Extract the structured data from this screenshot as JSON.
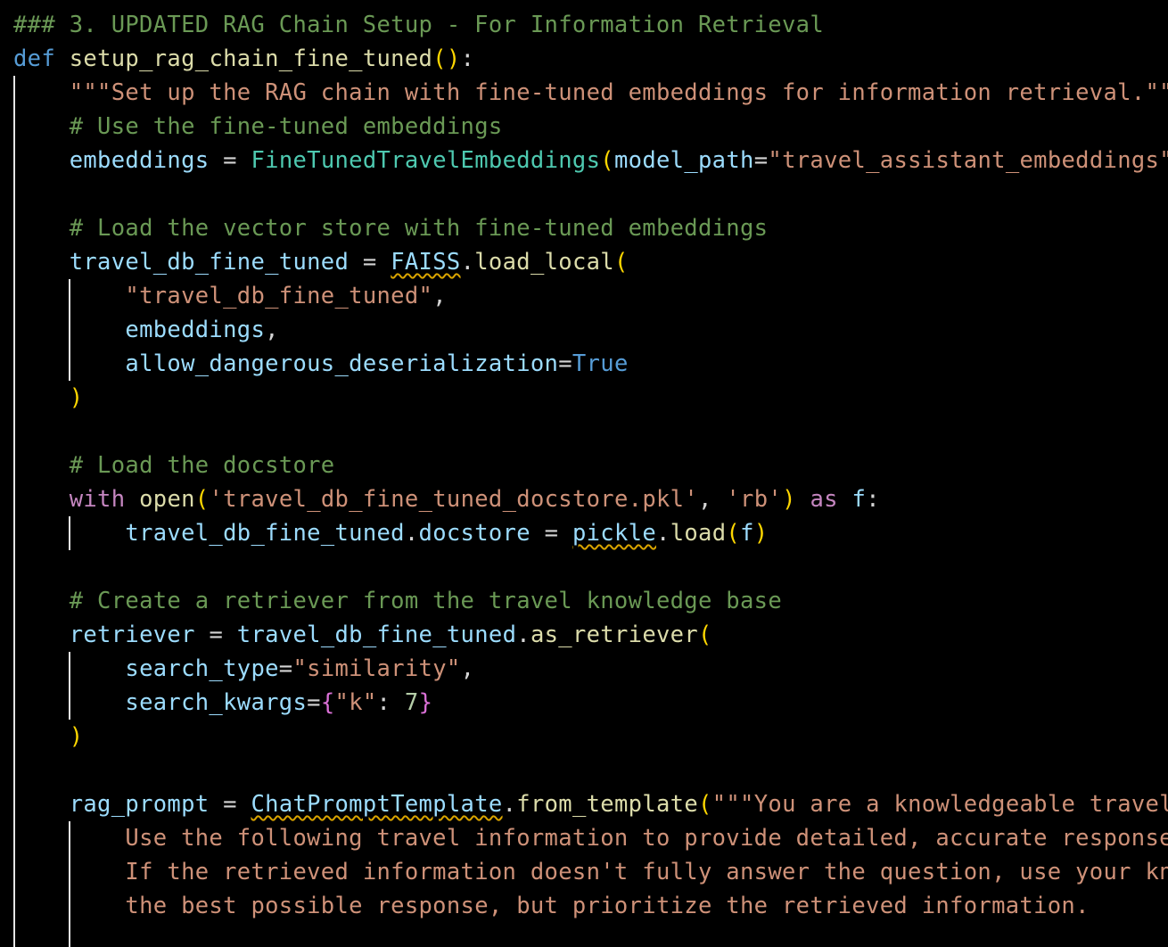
{
  "editor": {
    "language": "python",
    "theme_colors": {
      "background": "#000000",
      "comment": "#6a9955",
      "keyword": "#569cd6",
      "control": "#c586c0",
      "function": "#dcdcaa",
      "variable": "#9cdcfe",
      "class": "#4ec9b0",
      "string": "#ce9178",
      "number": "#b5cea8",
      "bracket_level_1": "#ffd700",
      "bracket_level_2": "#da70d6",
      "bracket_level_3": "#179fff",
      "warning_squiggle": "#d9a400",
      "indent_guide": "#e6e6e6"
    },
    "lines": [
      {
        "tokens": [
          {
            "t": "### 3. UPDATED RAG Chain Setup - For Information Retrieval",
            "c": "comment"
          }
        ]
      },
      {
        "tokens": [
          {
            "t": "def",
            "c": "keyword"
          },
          {
            "t": " ",
            "c": "op"
          },
          {
            "t": "setup_rag_chain_fine_tuned",
            "c": "func"
          },
          {
            "t": "()",
            "c": "bracket1"
          },
          {
            "t": ":",
            "c": "op"
          }
        ]
      },
      {
        "tokens": [
          {
            "t": "    ",
            "c": "op"
          },
          {
            "t": "\"\"\"Set up the RAG chain with fine-tuned embeddings for information retrieval.\"\"\"",
            "c": "string"
          }
        ]
      },
      {
        "tokens": [
          {
            "t": "    ",
            "c": "op"
          },
          {
            "t": "# Use the fine-tuned embeddings",
            "c": "comment"
          }
        ]
      },
      {
        "tokens": [
          {
            "t": "    ",
            "c": "op"
          },
          {
            "t": "embeddings",
            "c": "var"
          },
          {
            "t": " = ",
            "c": "op"
          },
          {
            "t": "FineTunedTravelEmbeddings",
            "c": "class"
          },
          {
            "t": "(",
            "c": "bracket1"
          },
          {
            "t": "model_path",
            "c": "var"
          },
          {
            "t": "=",
            "c": "op"
          },
          {
            "t": "\"travel_assistant_embeddings\"",
            "c": "string"
          },
          {
            "t": ")",
            "c": "bracket1"
          }
        ]
      },
      {
        "tokens": []
      },
      {
        "tokens": [
          {
            "t": "    ",
            "c": "op"
          },
          {
            "t": "# Load the vector store with fine-tuned embeddings",
            "c": "comment"
          }
        ]
      },
      {
        "tokens": [
          {
            "t": "    ",
            "c": "op"
          },
          {
            "t": "travel_db_fine_tuned",
            "c": "var"
          },
          {
            "t": " = ",
            "c": "op"
          },
          {
            "t": "FAISS",
            "c": "var",
            "warn": true
          },
          {
            "t": ".",
            "c": "op"
          },
          {
            "t": "load_local",
            "c": "func"
          },
          {
            "t": "(",
            "c": "bracket1"
          }
        ]
      },
      {
        "tokens": [
          {
            "t": "        ",
            "c": "op"
          },
          {
            "t": "\"travel_db_fine_tuned\"",
            "c": "string"
          },
          {
            "t": ",",
            "c": "op"
          }
        ]
      },
      {
        "tokens": [
          {
            "t": "        ",
            "c": "op"
          },
          {
            "t": "embeddings",
            "c": "var"
          },
          {
            "t": ",",
            "c": "op"
          }
        ]
      },
      {
        "tokens": [
          {
            "t": "        ",
            "c": "op"
          },
          {
            "t": "allow_dangerous_deserialization",
            "c": "var"
          },
          {
            "t": "=",
            "c": "op"
          },
          {
            "t": "True",
            "c": "keyword"
          }
        ]
      },
      {
        "tokens": [
          {
            "t": "    ",
            "c": "op"
          },
          {
            "t": ")",
            "c": "bracket1"
          }
        ]
      },
      {
        "tokens": []
      },
      {
        "tokens": [
          {
            "t": "    ",
            "c": "op"
          },
          {
            "t": "# Load the docstore",
            "c": "comment"
          }
        ]
      },
      {
        "tokens": [
          {
            "t": "    ",
            "c": "op"
          },
          {
            "t": "with",
            "c": "control"
          },
          {
            "t": " ",
            "c": "op"
          },
          {
            "t": "open",
            "c": "func"
          },
          {
            "t": "(",
            "c": "bracket1"
          },
          {
            "t": "'travel_db_fine_tuned_docstore.pkl'",
            "c": "string"
          },
          {
            "t": ", ",
            "c": "op"
          },
          {
            "t": "'rb'",
            "c": "string"
          },
          {
            "t": ")",
            "c": "bracket1"
          },
          {
            "t": " ",
            "c": "op"
          },
          {
            "t": "as",
            "c": "control"
          },
          {
            "t": " ",
            "c": "op"
          },
          {
            "t": "f",
            "c": "var"
          },
          {
            "t": ":",
            "c": "op"
          }
        ]
      },
      {
        "tokens": [
          {
            "t": "        ",
            "c": "op"
          },
          {
            "t": "travel_db_fine_tuned",
            "c": "var"
          },
          {
            "t": ".",
            "c": "op"
          },
          {
            "t": "docstore",
            "c": "var"
          },
          {
            "t": " = ",
            "c": "op"
          },
          {
            "t": "pickle",
            "c": "var",
            "warn": true
          },
          {
            "t": ".",
            "c": "op"
          },
          {
            "t": "load",
            "c": "func"
          },
          {
            "t": "(",
            "c": "bracket1"
          },
          {
            "t": "f",
            "c": "var"
          },
          {
            "t": ")",
            "c": "bracket1"
          }
        ]
      },
      {
        "tokens": []
      },
      {
        "tokens": [
          {
            "t": "    ",
            "c": "op"
          },
          {
            "t": "# Create a retriever from the travel knowledge base",
            "c": "comment"
          }
        ]
      },
      {
        "tokens": [
          {
            "t": "    ",
            "c": "op"
          },
          {
            "t": "retriever",
            "c": "var"
          },
          {
            "t": " = ",
            "c": "op"
          },
          {
            "t": "travel_db_fine_tuned",
            "c": "var"
          },
          {
            "t": ".",
            "c": "op"
          },
          {
            "t": "as_retriever",
            "c": "func"
          },
          {
            "t": "(",
            "c": "bracket1"
          }
        ]
      },
      {
        "tokens": [
          {
            "t": "        ",
            "c": "op"
          },
          {
            "t": "search_type",
            "c": "var"
          },
          {
            "t": "=",
            "c": "op"
          },
          {
            "t": "\"similarity\"",
            "c": "string"
          },
          {
            "t": ",",
            "c": "op"
          }
        ]
      },
      {
        "tokens": [
          {
            "t": "        ",
            "c": "op"
          },
          {
            "t": "search_kwargs",
            "c": "var"
          },
          {
            "t": "=",
            "c": "op"
          },
          {
            "t": "{",
            "c": "bracket2"
          },
          {
            "t": "\"k\"",
            "c": "string"
          },
          {
            "t": ": ",
            "c": "op"
          },
          {
            "t": "7",
            "c": "number"
          },
          {
            "t": "}",
            "c": "bracket2"
          }
        ]
      },
      {
        "tokens": [
          {
            "t": "    ",
            "c": "op"
          },
          {
            "t": ")",
            "c": "bracket1"
          }
        ]
      },
      {
        "tokens": []
      },
      {
        "tokens": [
          {
            "t": "    ",
            "c": "op"
          },
          {
            "t": "rag_prompt",
            "c": "var"
          },
          {
            "t": " = ",
            "c": "op"
          },
          {
            "t": "ChatPromptTemplate",
            "c": "var",
            "warn": true
          },
          {
            "t": ".",
            "c": "op"
          },
          {
            "t": "from_template",
            "c": "func"
          },
          {
            "t": "(",
            "c": "bracket1"
          },
          {
            "t": "\"\"\"You are a knowledgeable travel",
            "c": "string"
          }
        ]
      },
      {
        "tokens": [
          {
            "t": "        ",
            "c": "op"
          },
          {
            "t": "Use the following travel information to provide detailed, accurate responses",
            "c": "string"
          }
        ]
      },
      {
        "tokens": [
          {
            "t": "        ",
            "c": "op"
          },
          {
            "t": "If the retrieved information doesn't fully answer the question, use your kno",
            "c": "string"
          }
        ]
      },
      {
        "tokens": [
          {
            "t": "        ",
            "c": "op"
          },
          {
            "t": "the best possible response, but prioritize the retrieved information.",
            "c": "string"
          }
        ]
      },
      {
        "tokens": []
      }
    ]
  }
}
